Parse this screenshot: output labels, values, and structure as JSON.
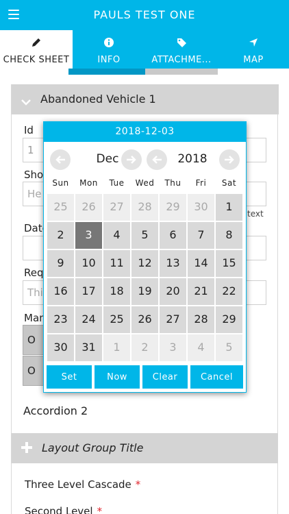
{
  "header": {
    "title": "PAULS TEST ONE"
  },
  "tabs": [
    {
      "label": "CHECK SHEET",
      "icon": "pencil-icon"
    },
    {
      "label": "INFO",
      "icon": "info-icon"
    },
    {
      "label": "ATTACHME...",
      "icon": "tag-icon"
    },
    {
      "label": "MAP",
      "icon": "navigation-arrow-icon"
    }
  ],
  "accordion1": {
    "title": "Abandoned Vehicle 1"
  },
  "form": {
    "id_label": "Id",
    "id_value": "1",
    "short_label": "Sho",
    "short_placeholder": "He",
    "date_label": "Date",
    "req_label": "Req",
    "req_placeholder": "Thi",
    "text_hint": "text",
    "man_label": "Man",
    "opt1_label": "O",
    "opt2_label": "O"
  },
  "accordion2": {
    "title": "Accordion 2"
  },
  "layout_group": {
    "title": "Layout Group Title"
  },
  "fields": {
    "cascade_label": "Three Level Cascade",
    "second_label": "Second Level",
    "required_mark": "*"
  },
  "datepicker": {
    "selected_date": "2018-12-03",
    "month": "Dec",
    "year": "2018",
    "weekdays": [
      "Sun",
      "Mon",
      "Tue",
      "Wed",
      "Thu",
      "Fri",
      "Sat"
    ],
    "weeks": [
      [
        "25",
        "26",
        "27",
        "28",
        "29",
        "30",
        "1"
      ],
      [
        "2",
        "3",
        "4",
        "5",
        "6",
        "7",
        "8"
      ],
      [
        "9",
        "10",
        "11",
        "12",
        "13",
        "14",
        "15"
      ],
      [
        "16",
        "17",
        "18",
        "19",
        "20",
        "21",
        "22"
      ],
      [
        "23",
        "24",
        "25",
        "26",
        "27",
        "28",
        "29"
      ],
      [
        "30",
        "31",
        "1",
        "2",
        "3",
        "4",
        "5"
      ]
    ],
    "selected_cell": "3",
    "buttons": {
      "set": "Set",
      "now": "Now",
      "clear": "Clear",
      "cancel": "Cancel"
    }
  },
  "colors": {
    "accent": "#00b6e8",
    "tab_indicator": "#0397c5",
    "selected_day": "#777777",
    "required": "#e0262e"
  }
}
